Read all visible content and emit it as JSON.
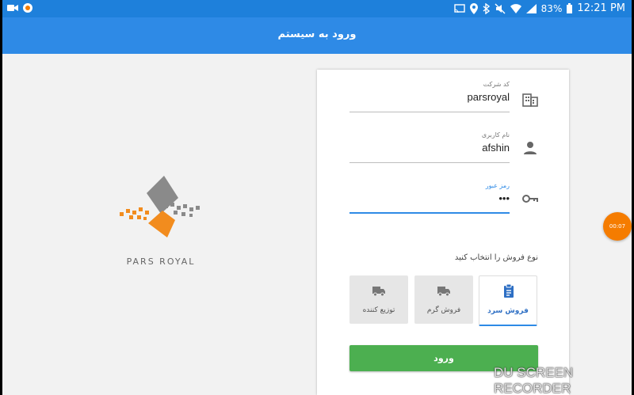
{
  "status_bar": {
    "battery": "83%",
    "time": "12:21 PM",
    "icons": [
      "video-icon",
      "recorder-icon",
      "cast-icon",
      "location-icon",
      "bluetooth-icon",
      "mute-icon",
      "wifi-icon",
      "signal-icon",
      "battery-icon"
    ]
  },
  "app_bar": {
    "title": "ورود به سیستم"
  },
  "logo": {
    "text": "PARS ROYAL"
  },
  "form": {
    "company": {
      "label": "کد شرکت",
      "value": "parsroyal",
      "icon": "building-icon"
    },
    "username": {
      "label": "نام کاربری",
      "value": "afshin",
      "icon": "person-icon"
    },
    "password": {
      "label": "رمز عبور",
      "value": "•••",
      "icon": "key-icon"
    },
    "sale_type_label": "نوع فروش را انتخاب کنید",
    "options": [
      {
        "label": "فروش سرد",
        "icon": "clipboard-icon",
        "selected": true
      },
      {
        "label": "فروش گرم",
        "icon": "truck-icon",
        "selected": false
      },
      {
        "label": "توزیع کننده",
        "icon": "truck-icon",
        "selected": false
      }
    ],
    "login_button": "ورود"
  },
  "recorder": {
    "timer": "00:07",
    "watermark": "DU SCREEN RECORDER"
  },
  "colors": {
    "primary": "#2e8ae6",
    "status": "#1e80db",
    "accent": "#f57c00",
    "button": "#4caf50"
  }
}
